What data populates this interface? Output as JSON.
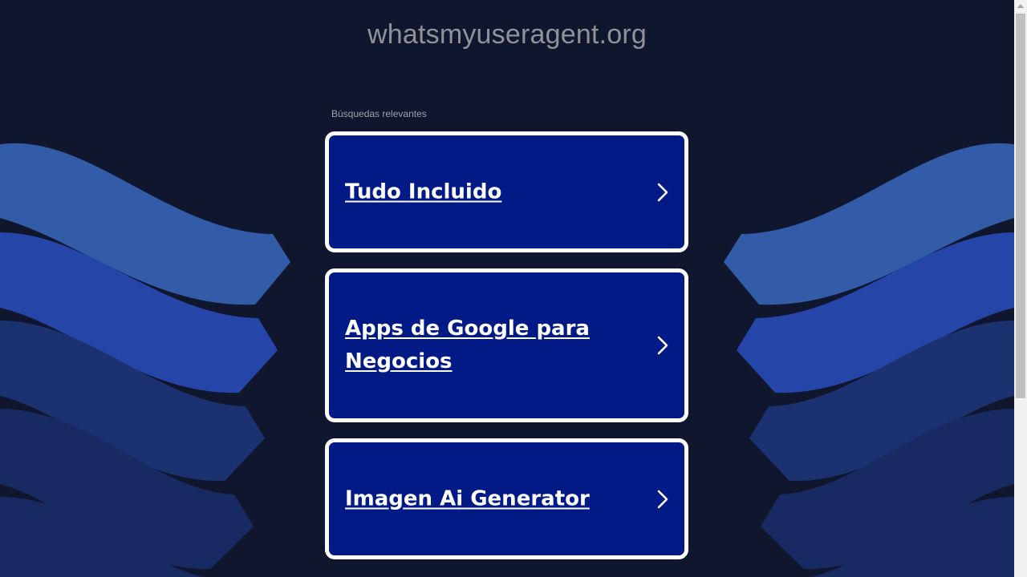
{
  "site": {
    "domain": "whatsmyuseragent.org"
  },
  "related": {
    "label": "Búsquedas relevantes",
    "items": [
      {
        "label": "Tudo Incluido"
      },
      {
        "label": "Apps de Google para Negocios"
      },
      {
        "label": "Imagen Ai Generator"
      }
    ]
  },
  "icons": {
    "card_arrow": "chevron-right-icon"
  },
  "colors": {
    "background": "#0f162e",
    "card_fill": "#021a86",
    "card_border": "#ffffff",
    "title_text": "#8f9398",
    "wave_light": "#325ca8",
    "wave_mid": "#2546a8",
    "wave_dark": "#1c3270",
    "wave_darkest": "#172a62"
  }
}
